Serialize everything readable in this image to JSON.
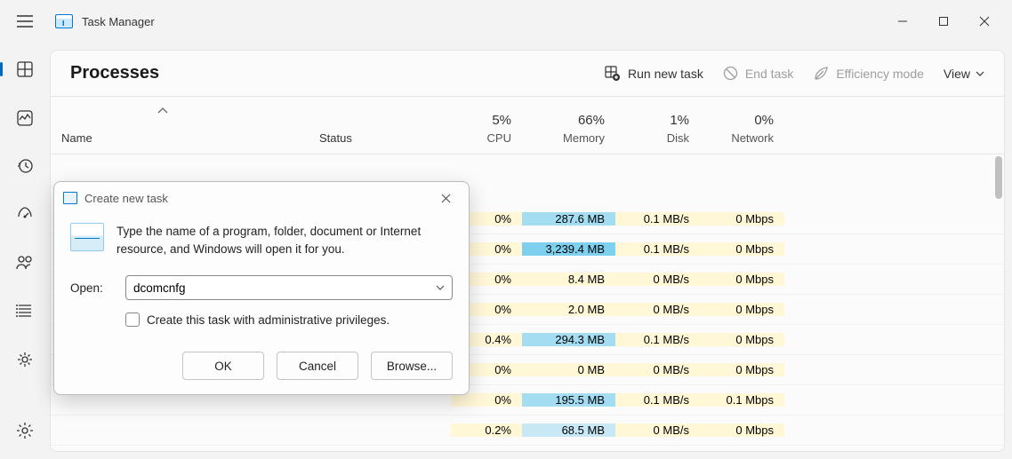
{
  "app": {
    "title": "Task Manager"
  },
  "window_controls": {
    "minimize": "—",
    "maximize": "▢",
    "close": "✕"
  },
  "sidebar": {
    "items": [
      {
        "name": "processes",
        "active": true
      },
      {
        "name": "performance"
      },
      {
        "name": "app-history"
      },
      {
        "name": "startup-apps"
      },
      {
        "name": "users"
      },
      {
        "name": "details"
      },
      {
        "name": "services"
      }
    ],
    "settings": {
      "name": "settings"
    }
  },
  "header": {
    "title": "Processes",
    "run_new_task": "Run new task",
    "end_task": "End task",
    "efficiency_mode": "Efficiency mode",
    "view": "View"
  },
  "table": {
    "columns": {
      "name": "Name",
      "status": "Status",
      "cpu": {
        "pct": "5%",
        "label": "CPU"
      },
      "memory": {
        "pct": "66%",
        "label": "Memory"
      },
      "disk": {
        "pct": "1%",
        "label": "Disk"
      },
      "network": {
        "pct": "0%",
        "label": "Network"
      }
    },
    "rows": [
      {
        "cpu": "0%",
        "mem": "287.6 MB",
        "mem_class": "mem-high",
        "disk": "0.1 MB/s",
        "net": "0 Mbps"
      },
      {
        "cpu": "0%",
        "mem": "3,239.4 MB",
        "mem_class": "mem-vhigh",
        "disk": "0.1 MB/s",
        "net": "0 Mbps"
      },
      {
        "cpu": "0%",
        "mem": "8.4 MB",
        "mem_class": "mem-low",
        "disk": "0 MB/s",
        "net": "0 Mbps"
      },
      {
        "cpu": "0%",
        "mem": "2.0 MB",
        "mem_class": "mem-low",
        "disk": "0 MB/s",
        "net": "0 Mbps"
      },
      {
        "cpu": "0.4%",
        "mem": "294.3 MB",
        "mem_class": "mem-high",
        "disk": "0.1 MB/s",
        "net": "0 Mbps"
      },
      {
        "cpu": "0%",
        "mem": "0 MB",
        "mem_class": "mem-low",
        "disk": "0 MB/s",
        "net": "0 Mbps"
      },
      {
        "cpu": "0%",
        "mem": "195.5 MB",
        "mem_class": "mem-high",
        "disk": "0.1 MB/s",
        "net": "0.1 Mbps"
      },
      {
        "cpu": "0.2%",
        "mem": "68.5 MB",
        "mem_class": "mem-med",
        "disk": "0 MB/s",
        "net": "0 Mbps"
      }
    ]
  },
  "dialog": {
    "title": "Create new task",
    "description": "Type the name of a program, folder, document or Internet resource, and Windows will open it for you.",
    "open_label": "Open:",
    "open_value": "dcomcnfg",
    "admin_label": "Create this task with administrative privileges.",
    "buttons": {
      "ok": "OK",
      "cancel": "Cancel",
      "browse": "Browse..."
    }
  }
}
